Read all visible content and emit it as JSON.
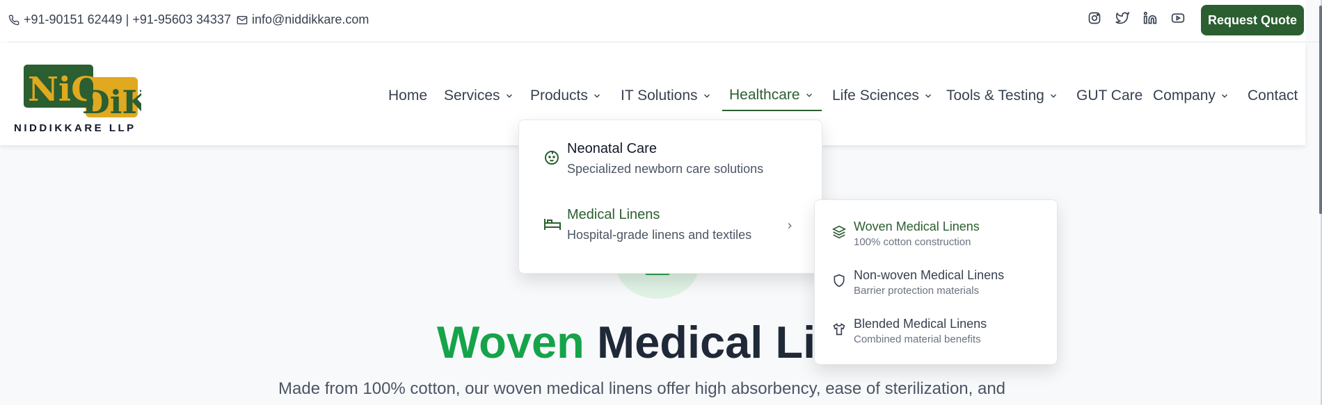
{
  "topbar": {
    "phone": "+91-90151 62449 | +91-95603 34337",
    "email": "info@niddikkare.com",
    "socials": [
      "instagram-icon",
      "twitter-icon",
      "linkedin-icon",
      "youtube-icon"
    ],
    "quote_label": "Request Quote"
  },
  "logo": {
    "mark_left": "NiC",
    "mark_right": "DiK",
    "tagline": "NIDDIKKARE LLP"
  },
  "nav": {
    "home": "Home",
    "services": "Services",
    "products": "Products",
    "it": "IT Solutions",
    "healthcare": "Healthcare",
    "life": "Life Sciences",
    "tools": "Tools & Testing",
    "gut": "GUT Care",
    "company": "Company",
    "contact": "Contact"
  },
  "dropdown": {
    "items": [
      {
        "title": "Neonatal Care",
        "desc": "Specialized newborn care solutions",
        "icon": "baby-icon"
      },
      {
        "title": "Medical Linens",
        "desc": "Hospital-grade linens and textiles",
        "icon": "bed-icon"
      }
    ]
  },
  "submenu": {
    "items": [
      {
        "title": "Woven Medical Linens",
        "desc": "100% cotton construction",
        "icon": "layers-icon"
      },
      {
        "title": "Non-woven Medical Linens",
        "desc": "Barrier protection materials",
        "icon": "shield-icon"
      },
      {
        "title": "Blended Medical Linens",
        "desc": "Combined material benefits",
        "icon": "shirt-icon"
      }
    ]
  },
  "hero": {
    "title_green": "Woven",
    "title_dark": " Medical Line",
    "subtitle": "Made from 100% cotton, our woven medical linens offer high absorbency, ease of sterilization, and"
  },
  "colors": {
    "brand": "#2b5e30",
    "accent": "#16a34a",
    "logo_gold": "#e0a91f"
  }
}
